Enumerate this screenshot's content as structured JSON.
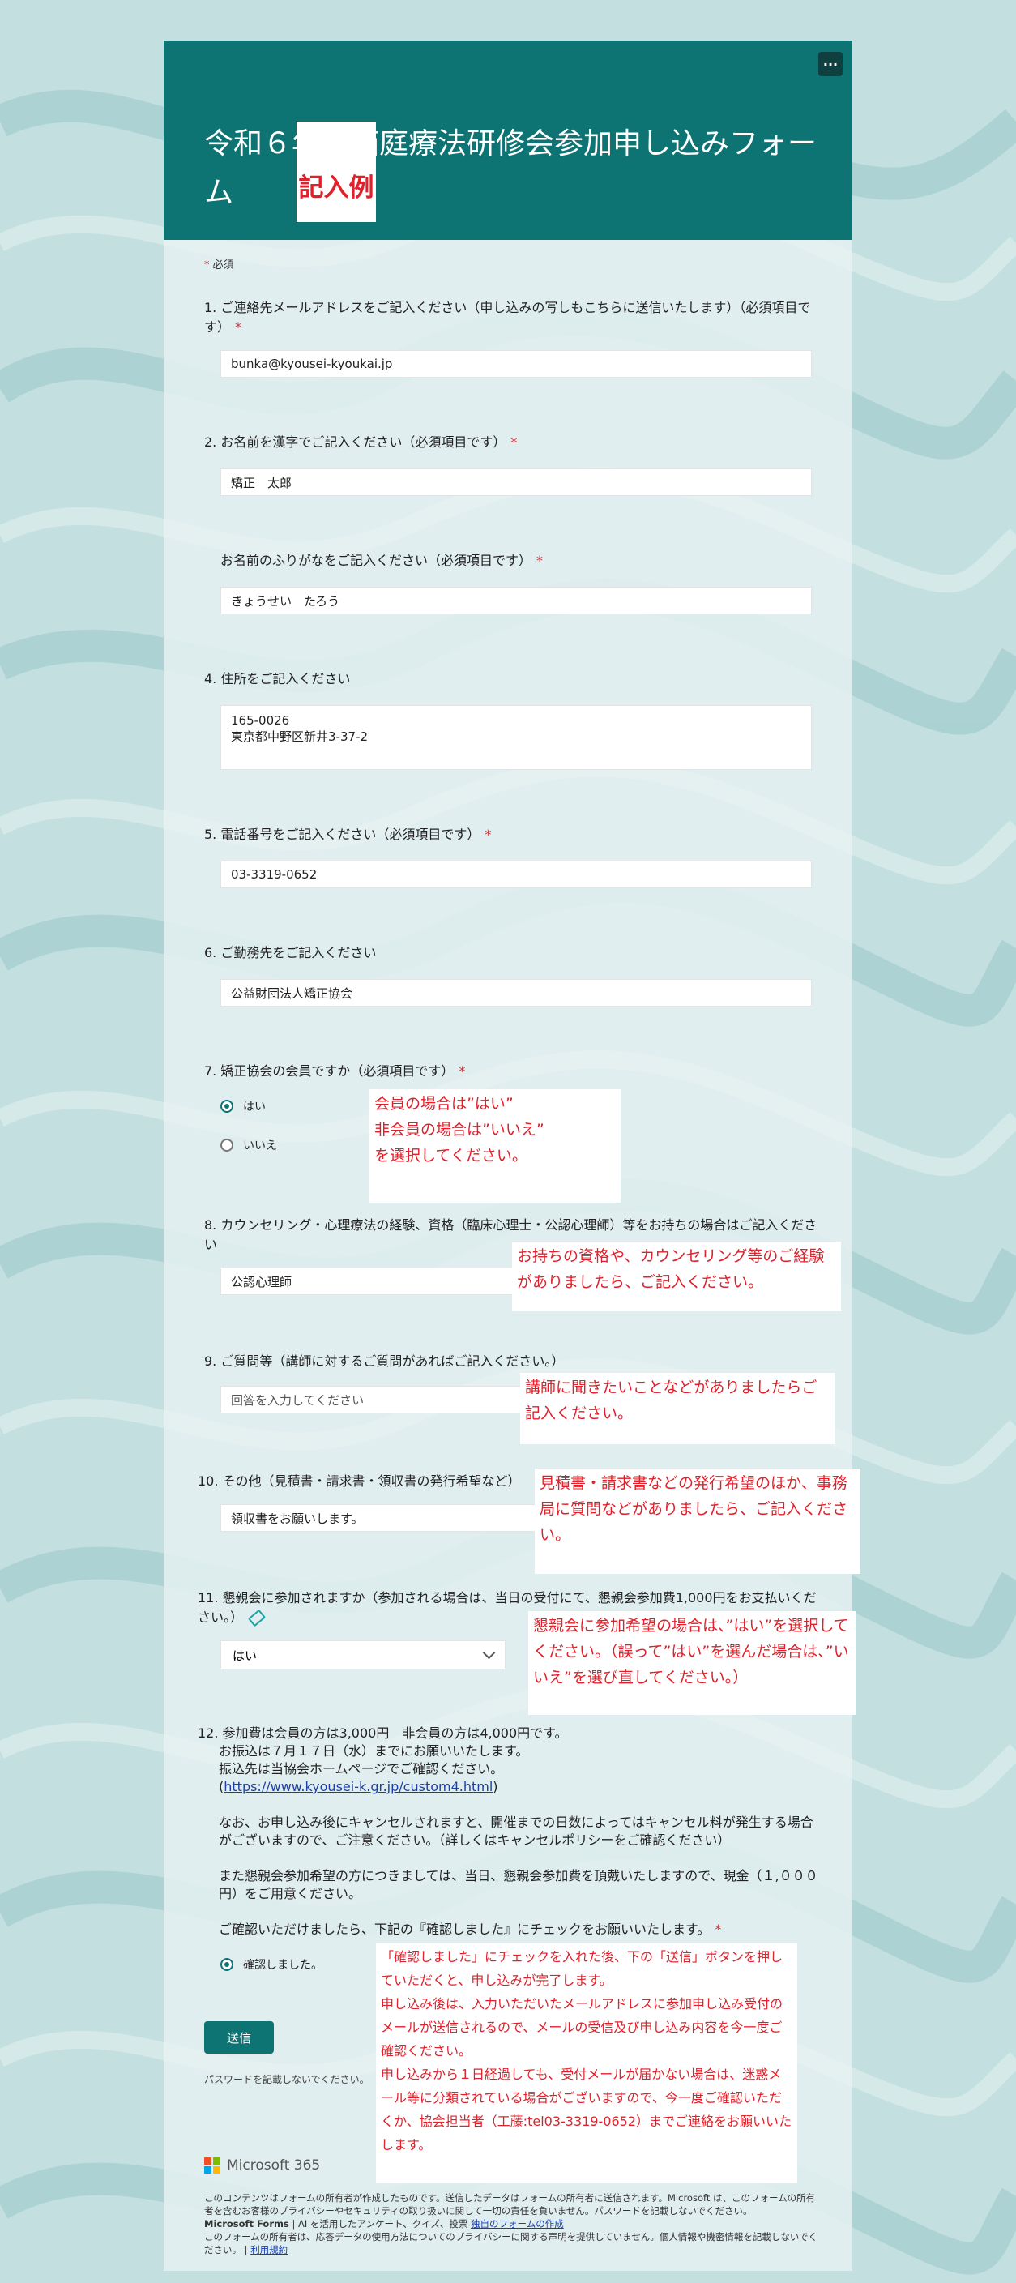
{
  "form": {
    "title": "令和６年度箱庭療法研修会参加申し込みフォーム",
    "badge": "記入例",
    "more_label": "···",
    "required_note": "必須"
  },
  "questions": {
    "q1": {
      "label": "1. ご連絡先メールアドレスをご記入ください（申し込みの写しもこちらに送信いたします）（必須項目です）",
      "value": "bunka@kyousei-kyoukai.jp"
    },
    "q2": {
      "label": "2. お名前を漢字でご記入ください（必須項目です）",
      "value": "矯正　太郎"
    },
    "q3": {
      "label": "お名前のふりがなをご記入ください（必須項目です）",
      "value": "きょうせい　たろう"
    },
    "q4": {
      "label": "4. 住所をご記入ください",
      "value": "165-0026\n東京都中野区新井3-37-2"
    },
    "q5": {
      "label": "5. 電話番号をご記入ください（必須項目です）",
      "value": "03-3319-0652"
    },
    "q6": {
      "label": "6. ご勤務先をご記入ください",
      "value": "公益財団法人矯正協会"
    },
    "q7": {
      "label": "7. 矯正協会の会員ですか（必須項目です）",
      "options": [
        "はい",
        "いいえ"
      ],
      "selected": "はい"
    },
    "q8": {
      "label": "8. カウンセリング・心理療法の経験、資格（臨床心理士・公認心理師）等をお持ちの場合はご記入ください",
      "value": "公認心理師"
    },
    "q9": {
      "label": "9. ご質問等（講師に対するご質問があればご記入ください。）",
      "placeholder": "回答を入力してください"
    },
    "q10": {
      "label": "10. その他（見積書・請求書・領収書の発行希望など）",
      "value": "領収書をお願いします。"
    },
    "q11": {
      "label": "11. 懇親会に参加されますか（参加される場合は、当日の受付にて、懇親会参加費1,000円をお支払いください。）",
      "value": "はい"
    },
    "q12": {
      "line1": "12. 参加費は会員の方は3,000円　非会員の方は4,000円です。",
      "line2": "お振込は７月１７日（水）までにお願いいたします。",
      "line3": "振込先は当協会ホームページでご確認ください。",
      "link": "https://www.kyousei-k.gr.jp/custom4.html",
      "para2": "なお、お申し込み後にキャンセルされますと、開催までの日数によってはキャンセル料が発生する場合がございますので、ご注意ください。（詳しくはキャンセルポリシーをご確認ください）",
      "para3": "また懇親会参加希望の方につきましては、当日、懇親会参加費を頂戴いたしますので、現金（１,０００円）をご用意ください。",
      "para4": "ご確認いただけましたら、下記の『確認しました』にチェックをお願いいたします。",
      "check_label": "確認しました。"
    }
  },
  "notes": {
    "n7": "会員の場合は”はい”\n非会員の場合は”いいえ”\nを選択してください。",
    "n8": "お持ちの資格や、カウンセリング等のご経験がありましたら、ご記入ください。",
    "n9": "講師に聞きたいことなどがありましたらご記入ください。",
    "n10": "見積書・請求書などの発行希望のほか、事務局に質問などがありましたら、ご記入ください。",
    "n11": "懇親会に参加希望の場合は、”はい”を選択してください。（誤って”はい”を選んだ場合は、”いいえ”を選び直してください。）",
    "n12": "「確認しました」にチェックを入れた後、下の「送信」ボタンを押していただくと、申し込みが完了します。\n申し込み後は、入力いただいたメールアドレスに参加申し込み受付のメールが送信されるので、メールの受信及び申し込み内容を今一度ご確認ください。\n申し込みから１日経過しても、受付メールが届かない場合は、迷惑メール等に分類されている場合がございますので、今一度ご確認いただくか、協会担当者（工藤:tel03-3319-0652）までご連絡をお願いいたします。"
  },
  "submit_label": "送信",
  "password_note": "パスワードを記載しないでください。",
  "brand": "Microsoft 365",
  "footer": {
    "line1": "このコンテンツはフォームの所有者が作成したものです。送信したデータはフォームの所有者に送信されます。Microsoft は、このフォームの所有者を含むお客様のプライバシーやセキュリティの取り扱いに関して一切の責任を負いません。パスワードを記載しないでください。",
    "line2_bold": "Microsoft Forms",
    "line2": " | AI を活用したアンケート、クイズ、投票 ",
    "line2_link": "独自のフォームの作成",
    "line3": "このフォームの所有者は、応答データの使用方法についてのプライバシーに関する声明を提供していません。個人情報や機密情報を記載しないでください。 | ",
    "line3_link": "利用規約"
  },
  "colors": {
    "header": "#0e7373",
    "accent": "#0e7373",
    "note_text": "#e0202a",
    "required": "#c0383c"
  }
}
